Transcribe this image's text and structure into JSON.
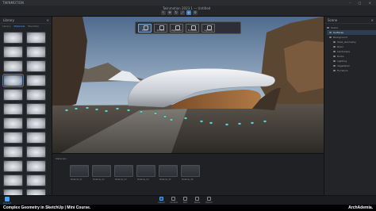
{
  "os_bar": {
    "title": "TWINMOTION"
  },
  "app": {
    "window_title": "Twinmotion 2023.1 — Untitled"
  },
  "toolbar": {
    "icons": [
      "select-icon",
      "move-icon",
      "rotate-icon",
      "scale-icon",
      "camera-icon",
      "settings-icon"
    ]
  },
  "left_panel": {
    "title": "Library",
    "tabs": [
      "Library",
      "Materials",
      "Favorites"
    ],
    "active_tab": "Materials"
  },
  "palette": {
    "buttons": [
      "Place",
      "Surface",
      "Vegetation",
      "Furniture",
      "Lighting"
    ]
  },
  "right_panel": {
    "title": "Scene",
    "tree": [
      {
        "label": "Scene",
        "level": 0,
        "selected": false
      },
      {
        "label": "Surfaces",
        "level": 1,
        "selected": true
      },
      {
        "label": "Background",
        "level": 1,
        "selected": false
      },
      {
        "label": "Shell_Geometry",
        "level": 2,
        "selected": false
      },
      {
        "label": "Road",
        "level": 2,
        "selected": false
      },
      {
        "label": "Landscape",
        "level": 2,
        "selected": false
      },
      {
        "label": "Rocks",
        "level": 2,
        "selected": false
      },
      {
        "label": "Lighting",
        "level": 2,
        "selected": false
      },
      {
        "label": "Vegetation",
        "level": 2,
        "selected": false
      },
      {
        "label": "Furniture",
        "level": 2,
        "selected": false
      }
    ]
  },
  "bottom_strip": {
    "label": "Materials",
    "materials": [
      "Material_01",
      "Material_02",
      "Material_03",
      "Material_04",
      "Material_05",
      "Material_06"
    ]
  },
  "dock": {
    "left_label": "Import",
    "buttons": [
      "Import",
      "Context",
      "Edit",
      "Media",
      "Export"
    ],
    "active": "Import"
  },
  "caption": {
    "title": "Complex Geometry in SketchUp | Mini Course.",
    "brand": "ArchAdemia."
  },
  "colors": {
    "accent": "#3b7fc4",
    "link": "#4aa3ff"
  }
}
